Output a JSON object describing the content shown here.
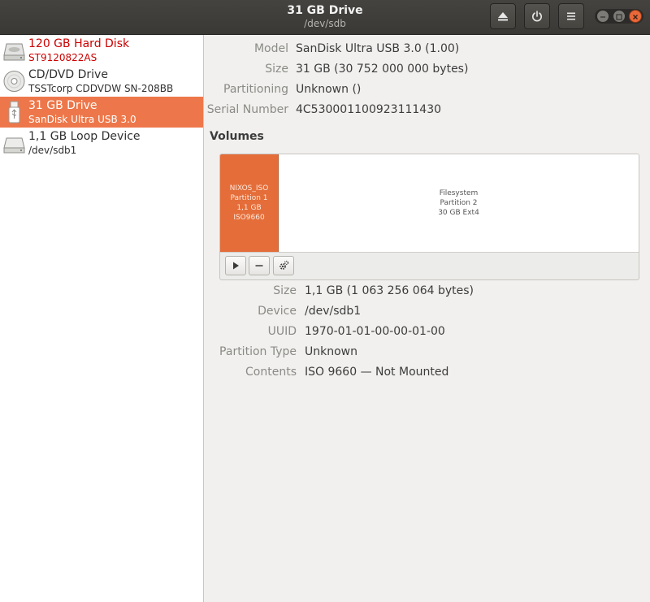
{
  "header": {
    "title": "31 GB Drive",
    "subtitle": "/dev/sdb"
  },
  "sidebar": {
    "items": [
      {
        "name": "120 GB Hard Disk",
        "detail": "ST9120822AS",
        "icon": "hard-disk-icon",
        "state": "error"
      },
      {
        "name": "CD/DVD Drive",
        "detail": "TSSTcorp CDDVDW SN-208BB",
        "icon": "optical-disc-icon",
        "state": "normal"
      },
      {
        "name": "31 GB Drive",
        "detail": "SanDisk Ultra USB 3.0",
        "icon": "usb-drive-icon",
        "state": "selected"
      },
      {
        "name": "1,1 GB Loop Device",
        "detail": "/dev/sdb1",
        "icon": "loop-device-icon",
        "state": "normal"
      }
    ]
  },
  "drive": {
    "model_label": "Model",
    "model": "SanDisk Ultra USB 3.0 (1.00)",
    "size_label": "Size",
    "size": "31 GB (30 752 000 000 bytes)",
    "partitioning_label": "Partitioning",
    "partitioning": "Unknown ()",
    "serial_label": "Serial Number",
    "serial": "4C530001100923111430"
  },
  "volumes": {
    "heading": "Volumes",
    "partitions": [
      {
        "name": "NIXOS_ISO",
        "label": "Partition 1",
        "desc": "1,1 GB ISO9660",
        "selected": true
      },
      {
        "name": "Filesystem",
        "label": "Partition 2",
        "desc": "30 GB Ext4",
        "selected": false
      }
    ]
  },
  "details": {
    "size_label": "Size",
    "size": "1,1 GB (1 063 256 064 bytes)",
    "device_label": "Device",
    "device": "/dev/sdb1",
    "uuid_label": "UUID",
    "uuid": "1970-01-01-00-00-01-00",
    "ptype_label": "Partition Type",
    "ptype": "Unknown",
    "contents_label": "Contents",
    "contents": "ISO 9660 — Not Mounted"
  },
  "colors": {
    "accent": "#ed774a",
    "partition_selected": "#e46d39",
    "error_text": "#cc0000",
    "header_bg": "#3d3c38"
  }
}
